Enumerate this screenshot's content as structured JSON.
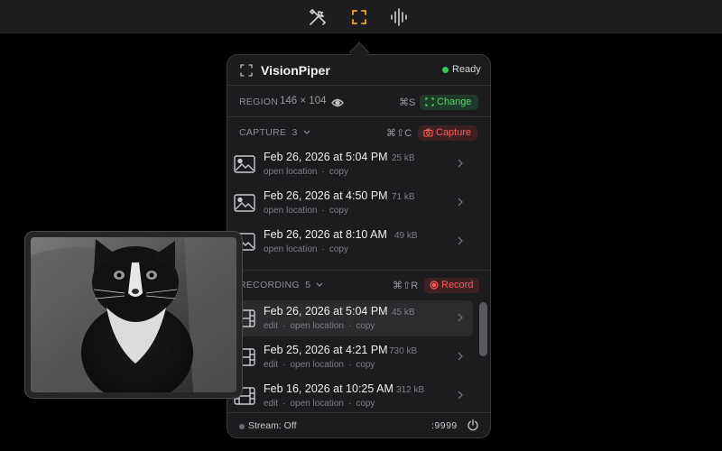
{
  "menubar": {
    "icons": [
      "tools-icon",
      "frame-select-icon",
      "waveform-icon"
    ],
    "accent": "#f5a623"
  },
  "app": {
    "title": "VisionPiper",
    "status": "Ready",
    "status_color": "#34c759"
  },
  "region": {
    "label": "REGION",
    "size": "146 × 104",
    "shortcut": "⌘S",
    "change_label": "Change"
  },
  "capture": {
    "label": "CAPTURE",
    "count": "3",
    "shortcut": "⌘⇧C",
    "button_label": "Capture",
    "items": [
      {
        "date": "Feb 26, 2026 at 5:04 PM",
        "size": "25 kB",
        "link1": "open location",
        "link2": "copy"
      },
      {
        "date": "Feb 26, 2026 at 4:50 PM",
        "size": "71 kB",
        "link1": "open location",
        "link2": "copy"
      },
      {
        "date": "Feb 26, 2026 at 8:10 AM",
        "size": "49 kB",
        "link1": "open location",
        "link2": "copy"
      }
    ]
  },
  "recording": {
    "label": "RECORDING",
    "count": "5",
    "shortcut": "⌘⇧R",
    "button_label": "Record",
    "items": [
      {
        "date": "Feb 26, 2026 at 5:04 PM",
        "size": "45 kB",
        "link1": "edit",
        "link2": "open location",
        "link3": "copy"
      },
      {
        "date": "Feb 25, 2026 at 4:21 PM",
        "size": "730 kB",
        "link1": "edit",
        "link2": "open location",
        "link3": "copy"
      },
      {
        "date": "Feb 16, 2026 at 10:25 AM",
        "size": "312 kB",
        "link1": "edit",
        "link2": "open location",
        "link3": "copy"
      }
    ]
  },
  "footer": {
    "stream": "Stream: Off",
    "port": ":9999"
  }
}
